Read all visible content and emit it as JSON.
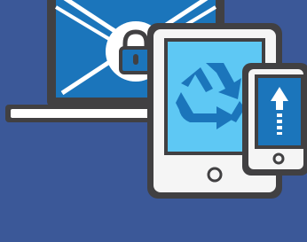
{
  "scene": {
    "background_color": "#3b5898",
    "device_frame_color": "#414042",
    "device_body_color": "#f5f5f5",
    "screen_color": "#1b75bb",
    "screen_light_color": "#5ec8f4",
    "accent_white": "#ffffff"
  },
  "icons": {
    "laptop": "laptop-icon",
    "envelope": "envelope-icon",
    "padlock": "padlock-icon",
    "tablet": "tablet-icon",
    "recycle": "recycle-icon",
    "phone": "smartphone-icon",
    "upload": "upload-arrow-icon"
  }
}
